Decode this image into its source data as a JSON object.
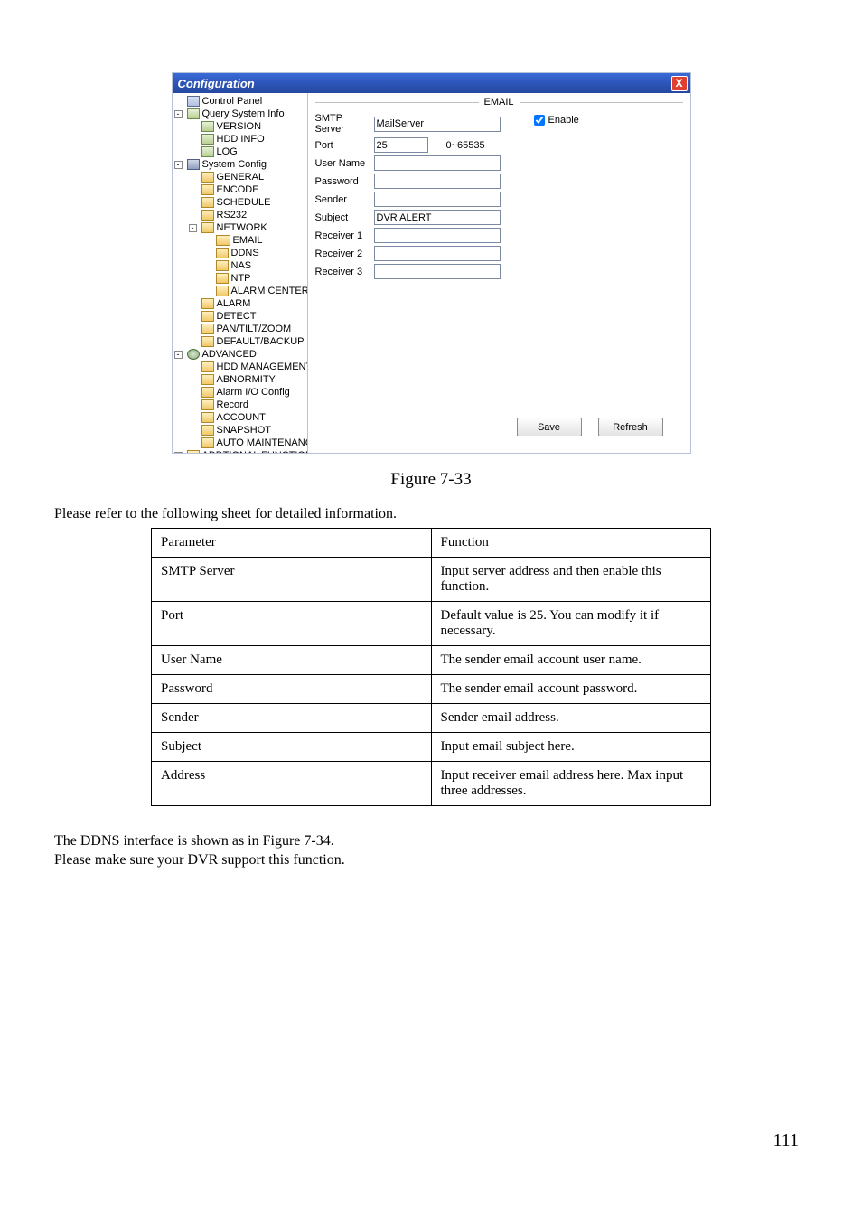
{
  "window": {
    "title": "Configuration",
    "close": "X"
  },
  "tree": {
    "root": "Control Panel",
    "query": "Query System Info",
    "version": "VERSION",
    "hdd_info": "HDD INFO",
    "log": "LOG",
    "system_config": "System Config",
    "general": "GENERAL",
    "encode": "ENCODE",
    "schedule": "SCHEDULE",
    "rs232": "RS232",
    "network": "NETWORK",
    "email": "EMAIL",
    "ddns": "DDNS",
    "nas": "NAS",
    "ntp": "NTP",
    "alarm_center": "ALARM CENTER",
    "alarm": "ALARM",
    "detect": "DETECT",
    "pan_tilt_zoom": "PAN/TILT/ZOOM",
    "default_backup": "DEFAULT/BACKUP",
    "advanced": "ADVANCED",
    "hdd_mgmt": "HDD MANAGEMENT",
    "abnormity": "ABNORMITY",
    "alarm_io": "Alarm I/O Config",
    "record": "Record",
    "account": "ACCOUNT",
    "snapshot": "SNAPSHOT",
    "auto_maint": "AUTO MAINTENANCE",
    "addtional": "ADDTIONAL FUNCTION"
  },
  "form": {
    "section_title": "EMAIL",
    "smtp_label": "SMTP Server",
    "smtp_value": "MailServer",
    "port_label": "Port",
    "port_value": "25",
    "port_range": "0~65535",
    "username_label": "User Name",
    "password_label": "Password",
    "sender_label": "Sender",
    "subject_label": "Subject",
    "subject_value": "DVR ALERT",
    "receiver1_label": "Receiver 1",
    "receiver2_label": "Receiver 2",
    "receiver3_label": "Receiver 3",
    "enable_label": "Enable",
    "save_btn": "Save",
    "refresh_btn": "Refresh"
  },
  "page": {
    "figure_caption": "Figure 7-33",
    "intro": "Please refer to the following sheet for detailed information.",
    "table_header_param": "Parameter",
    "table_header_func": "Function",
    "rows": {
      "smtp_p": "SMTP Server",
      "smtp_f": "Input server address and then enable this function.",
      "port_p": "Port",
      "port_f": "Default value is 25. You can modify it if necessary.",
      "user_p": "User Name",
      "user_f": "The sender email account user name.",
      "pass_p": "Password",
      "pass_f": "The sender email account password.",
      "send_p": "Sender",
      "send_f": "Sender email address.",
      "subj_p": "Subject",
      "subj_f": "Input email subject here.",
      "addr_p": "Address",
      "addr_f": "Input receiver email address here. Max input three addresses."
    },
    "body1": "The DDNS interface is shown as in Figure 7-34.",
    "body2": "Please make sure your DVR support this function.",
    "page_number": "111"
  }
}
